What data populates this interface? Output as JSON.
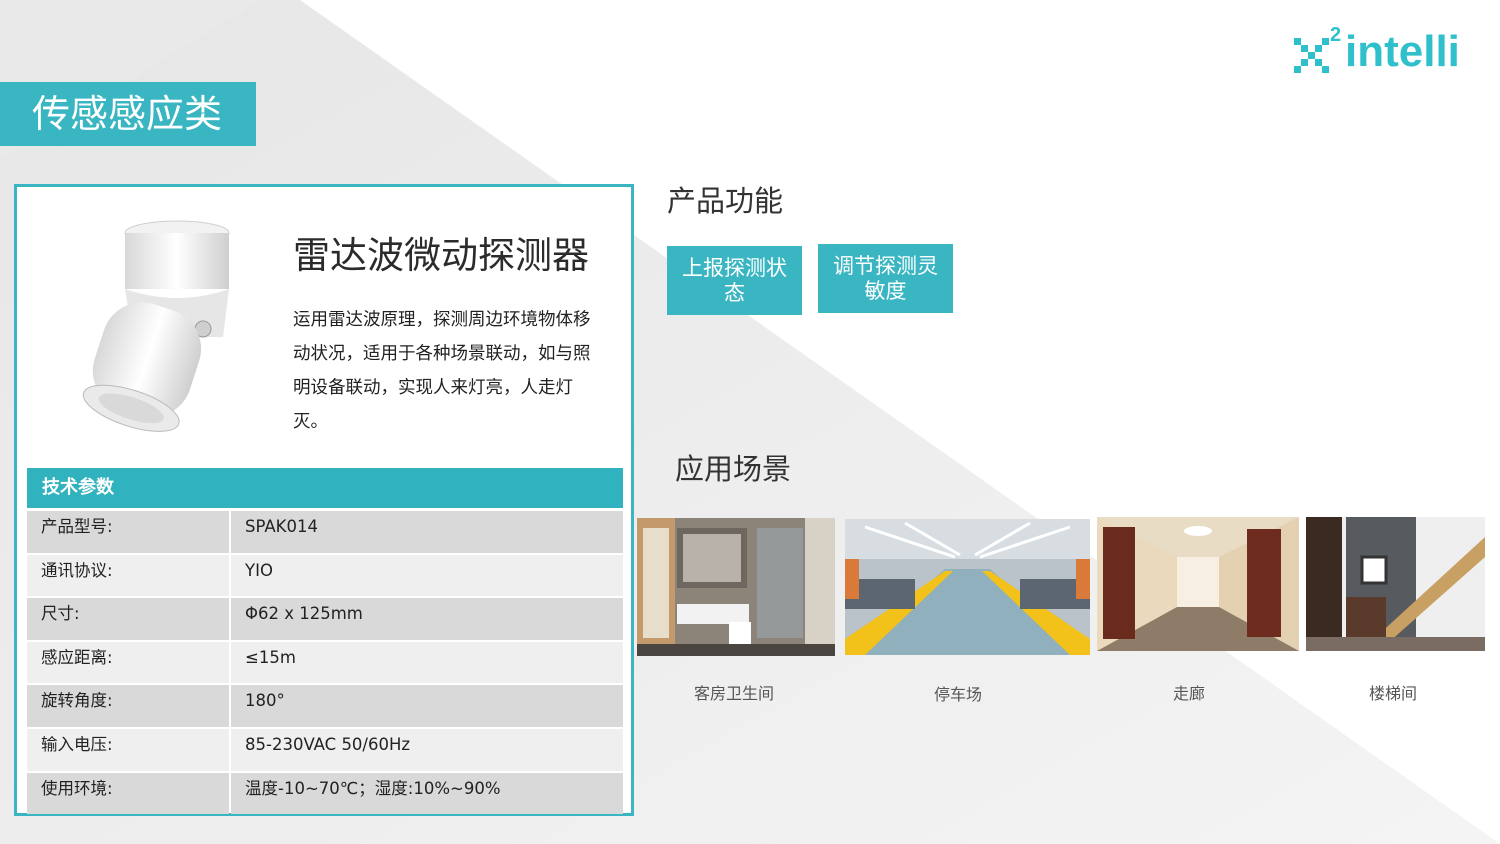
{
  "brand": {
    "logo_sup": "2",
    "logo_text": "intelli",
    "accent": "#3ab6c3"
  },
  "category": "传感感应类",
  "product": {
    "name": "雷达波微动探测器",
    "description": "运用雷达波原理，探测周边环境物体移动状况，适用于各种场景联动，如与照明设备联动，实现人来灯亮，人走灯灭。"
  },
  "specs": {
    "header": "技术参数",
    "rows": [
      {
        "key": "产品型号:",
        "value": "SPAK014"
      },
      {
        "key": "通讯协议:",
        "value": "YIO"
      },
      {
        "key": "尺寸:",
        "value": "Φ62 x 125mm"
      },
      {
        "key": "感应距离:",
        "value": "≤15m"
      },
      {
        "key": "旋转角度:",
        "value": "180°"
      },
      {
        "key": "输入电压:",
        "value": "85-230VAC 50/60Hz"
      },
      {
        "key": "使用环境:",
        "value": "温度-10~70℃；湿度:10%~90%"
      }
    ]
  },
  "features": {
    "title": "产品功能",
    "buttons": [
      "上报探测状态",
      "调节探测灵敏度"
    ]
  },
  "scenes": {
    "title": "应用场景",
    "items": [
      "客房卫生间",
      "停车场",
      "走廊",
      "楼梯间"
    ]
  }
}
